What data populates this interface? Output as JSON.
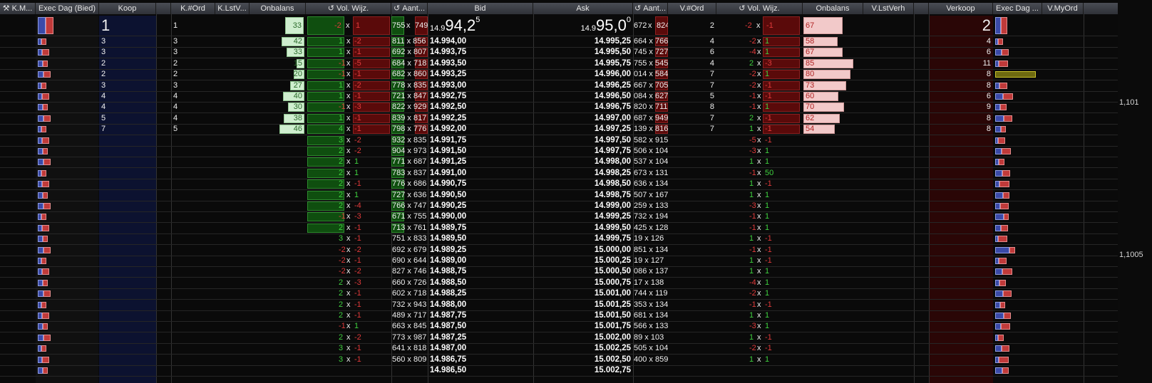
{
  "headers": {
    "km": "K.M...",
    "exec_bid": "Exec Dag (Bied)",
    "koop": "Koop",
    "k_ord": "K.#Ord",
    "k_lstv": "K.LstV...",
    "onbalans_bid": "Onbalans",
    "vol_wijz_bid": "Vol. Wijz.",
    "aant_bid": "Aant...",
    "bid": "Bid",
    "ask": "Ask",
    "aant_ask": "Aant...",
    "v_ord": "V.#Ord",
    "vol_wijz_ask": "Vol. Wijz.",
    "onbalans_ask": "Onbalans",
    "v_lstverh": "V.LstVerh",
    "verkoop": "Verkoop",
    "exec_ask": "Exec Dag ...",
    "v_myord": "V.MyOrd"
  },
  "side_axis": [
    "1,101",
    "1,1005"
  ],
  "top": {
    "koop": "1",
    "k_ord": "1",
    "onbalans_bid": "33",
    "vol_bid": [
      "-2",
      "x",
      "1"
    ],
    "aant_bid": [
      "755",
      "x",
      "749"
    ],
    "bid_prefix": "14.9",
    "bid_main": "94,2",
    "bid_sup": "5",
    "ask_prefix": "14.9",
    "ask_main": "95,0",
    "ask_sup": "0",
    "aant_ask": [
      "672",
      "x",
      "824"
    ],
    "v_ord": "2",
    "vol_ask": [
      "-2",
      "x",
      "-1"
    ],
    "onbalans_ask": "67",
    "verkoop": "2"
  },
  "rows": [
    {
      "koop": "3",
      "kord": "3",
      "onb": "42",
      "v1": "1",
      "v2": "-2",
      "a": "811 x 856",
      "bid": "14.994,00",
      "ask": "14.995,25",
      "aa": "664 x 766",
      "vord": "4",
      "w1": "-2",
      "w2": "1",
      "onba": "58",
      "verk": "4"
    },
    {
      "koop": "3",
      "kord": "3",
      "onb": "33",
      "v1": "1",
      "v2": "-1",
      "a": "692 x 807",
      "bid": "14.993,75",
      "ask": "14.995,50",
      "aa": "745 x 727",
      "vord": "6",
      "w1": "-4",
      "w2": "1",
      "onba": "67",
      "verk": "6"
    },
    {
      "koop": "2",
      "kord": "2",
      "onb": "15",
      "v1": "-1",
      "v2": "-5",
      "a": "684 x 718",
      "bid": "14.993,50",
      "ask": "14.995,75",
      "aa": "755 x 545",
      "vord": "4",
      "w1": "2",
      "w2": "-3",
      "onba": "85",
      "verk": "11"
    },
    {
      "koop": "2",
      "kord": "2",
      "onb": "20",
      "v1": "-1",
      "v2": "-1",
      "a": "682 x 860",
      "bid": "14.993,25",
      "ask": "14.996,00",
      "aa": "014 x 584",
      "vord": "7",
      "w1": "-2",
      "w2": "1",
      "onba": "80",
      "verk": "8"
    },
    {
      "koop": "3",
      "kord": "3",
      "onb": "27",
      "v1": "1",
      "v2": "-2",
      "a": "778 x 835",
      "bid": "14.993,00",
      "ask": "14.996,25",
      "aa": "667 x 705",
      "vord": "7",
      "w1": "-2",
      "w2": "-1",
      "onba": "73",
      "verk": "8"
    },
    {
      "koop": "4",
      "kord": "4",
      "onb": "40",
      "v1": "1",
      "v2": "-1",
      "a": "721 x 847",
      "bid": "14.992,75",
      "ask": "14.996,50",
      "aa": "084 x 627",
      "vord": "5",
      "w1": "-1",
      "w2": "-1",
      "onba": "60",
      "verk": "6"
    },
    {
      "koop": "4",
      "kord": "4",
      "onb": "30",
      "v1": "-1",
      "v2": "-3",
      "a": "822 x 929",
      "bid": "14.992,50",
      "ask": "14.996,75",
      "aa": "820 x 711",
      "vord": "8",
      "w1": "-1",
      "w2": "1",
      "onba": "70",
      "verk": "9"
    },
    {
      "koop": "5",
      "kord": "4",
      "onb": "38",
      "v1": "1",
      "v2": "-1",
      "a": "839 x 817",
      "bid": "14.992,25",
      "ask": "14.997,00",
      "aa": "687 x 949",
      "vord": "7",
      "w1": "2",
      "w2": "-1",
      "onba": "62",
      "verk": "8"
    },
    {
      "koop": "7",
      "kord": "5",
      "onb": "46",
      "v1": "4",
      "v2": "-1",
      "a": "798 x 776",
      "bid": "14.992,00",
      "ask": "14.997,25",
      "aa": "139 x 816",
      "vord": "7",
      "w1": "1",
      "w2": "-1",
      "onba": "54",
      "verk": "8"
    },
    {
      "v1": "3",
      "v2": "-2",
      "a": "932 x 835",
      "bid": "14.991,75",
      "ask": "14.997,50",
      "aa": "582 x 915",
      "w1": "-5",
      "w2": "-1"
    },
    {
      "v1": "2",
      "v2": "-2",
      "a": "904 x 973",
      "bid": "14.991,50",
      "ask": "14.997,75",
      "aa": "506 x 104",
      "w1": "-3",
      "w2": "1"
    },
    {
      "v1": "2",
      "v2": "1",
      "a": "771 x 687",
      "bid": "14.991,25",
      "ask": "14.998,00",
      "aa": "537 x 104",
      "w1": "1",
      "w2": "1"
    },
    {
      "v1": "2",
      "v2": "1",
      "a": "783 x 837",
      "bid": "14.991,00",
      "ask": "14.998,25",
      "aa": "673 x 131",
      "w1": "-1",
      "w2": "50"
    },
    {
      "v1": "2",
      "v2": "-1",
      "a": "776 x 686",
      "bid": "14.990,75",
      "ask": "14.998,50",
      "aa": "636 x 134",
      "w1": "1",
      "w2": "-1"
    },
    {
      "v1": "2",
      "v2": "1",
      "a": "727 x 636",
      "bid": "14.990,50",
      "ask": "14.998,75",
      "aa": "507 x 167",
      "w1": "1",
      "w2": "1"
    },
    {
      "v1": "2",
      "v2": "-4",
      "a": "766 x 747",
      "bid": "14.990,25",
      "ask": "14.999,00",
      "aa": "259 x 133",
      "w1": "-3",
      "w2": "1"
    },
    {
      "v1": "-1",
      "v2": "-3",
      "a": "671 x 755",
      "bid": "14.990,00",
      "ask": "14.999,25",
      "aa": "732 x 194",
      "w1": "-1",
      "w2": "1"
    },
    {
      "v1": "2",
      "v2": "-1",
      "a": "713 x 761",
      "bid": "14.989,75",
      "ask": "14.999,50",
      "aa": "425 x 128",
      "w1": "-1",
      "w2": "1"
    },
    {
      "v1": "3",
      "v2": "-1",
      "a": "751 x 833",
      "bid": "14.989,50",
      "ask": "14.999,75",
      "aa": "19 x 126",
      "w1": "1",
      "w2": "-1"
    },
    {
      "v1": "-2",
      "v2": "-2",
      "a": "692 x 679",
      "bid": "14.989,25",
      "ask": "15.000,00",
      "aa": "851 x 134",
      "w1": "-1",
      "w2": "-1"
    },
    {
      "v1": "-2",
      "v2": "-1",
      "a": "690 x 644",
      "bid": "14.989,00",
      "ask": "15.000,25",
      "aa": "19 x 127",
      "w1": "1",
      "w2": "-1"
    },
    {
      "v1": "-2",
      "v2": "-2",
      "a": "827 x 746",
      "bid": "14.988,75",
      "ask": "15.000,50",
      "aa": "086 x 137",
      "w1": "1",
      "w2": "1"
    },
    {
      "v1": "2",
      "v2": "-3",
      "a": "660 x 726",
      "bid": "14.988,50",
      "ask": "15.000,75",
      "aa": "17 x 138",
      "w1": "-4",
      "w2": "1"
    },
    {
      "v1": "2",
      "v2": "-1",
      "a": "602 x 718",
      "bid": "14.988,25",
      "ask": "15.001,00",
      "aa": "744 x 119",
      "w1": "-2",
      "w2": "1"
    },
    {
      "v1": "2",
      "v2": "-1",
      "a": "732 x 943",
      "bid": "14.988,00",
      "ask": "15.001,25",
      "aa": "353 x 134",
      "w1": "-1",
      "w2": "-1"
    },
    {
      "v1": "2",
      "v2": "-1",
      "a": "489 x 717",
      "bid": "14.987,75",
      "ask": "15.001,50",
      "aa": "681 x 134",
      "w1": "1",
      "w2": "1"
    },
    {
      "v1": "-1",
      "v2": "1",
      "a": "663 x 845",
      "bid": "14.987,50",
      "ask": "15.001,75",
      "aa": "566 x 133",
      "w1": "-3",
      "w2": "1"
    },
    {
      "v1": "2",
      "v2": "-2",
      "a": "773 x 987",
      "bid": "14.987,25",
      "ask": "15.002,00",
      "aa": "89 x 103",
      "w1": "1",
      "w2": "-1"
    },
    {
      "v1": "3",
      "v2": "-1",
      "a": "641 x 818",
      "bid": "14.987,00",
      "ask": "15.002,25",
      "aa": "505 x 104",
      "w1": "-2",
      "w2": "-1"
    },
    {
      "v1": "3",
      "v2": "-1",
      "a": "560 x 809",
      "bid": "14.986,75",
      "ask": "15.002,50",
      "aa": "400 x 859",
      "w1": "1",
      "w2": "1"
    },
    {
      "v1": "",
      "v2": "",
      "a": "",
      "bid": "14.986,50",
      "ask": "15.002,75",
      "aa": "",
      "w1": "",
      "w2": ""
    }
  ]
}
